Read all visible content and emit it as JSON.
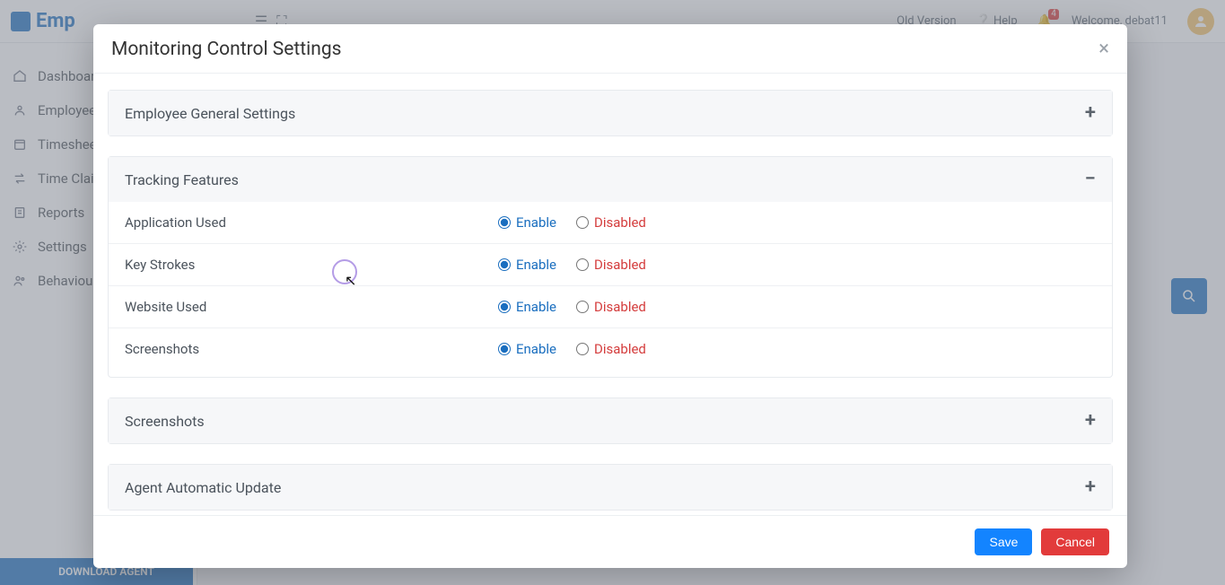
{
  "header": {
    "brand": "Emp",
    "old_version": "Old Version",
    "help": "Help",
    "welcome": "Welcome, debat11",
    "notification_badge": "4"
  },
  "sidebar": {
    "items": [
      {
        "label": "Dashboard"
      },
      {
        "label": "Employee"
      },
      {
        "label": "Timesheets"
      },
      {
        "label": "Time Claim"
      },
      {
        "label": "Reports"
      },
      {
        "label": "Settings"
      },
      {
        "label": "Behaviour"
      }
    ],
    "download": "DOWNLOAD AGENT"
  },
  "modal": {
    "title": "Monitoring Control Settings",
    "sections": {
      "general": "Employee General Settings",
      "tracking": "Tracking Features",
      "screenshots": "Screenshots",
      "autoupdate": "Agent Automatic Update"
    },
    "labels": {
      "enable": "Enable",
      "disabled": "Disabled"
    },
    "tracking_features": [
      {
        "label": "Application Used",
        "value": "enable"
      },
      {
        "label": "Key Strokes",
        "value": "enable"
      },
      {
        "label": "Website Used",
        "value": "enable"
      },
      {
        "label": "Screenshots",
        "value": "enable"
      }
    ],
    "buttons": {
      "save": "Save",
      "cancel": "Cancel"
    }
  }
}
